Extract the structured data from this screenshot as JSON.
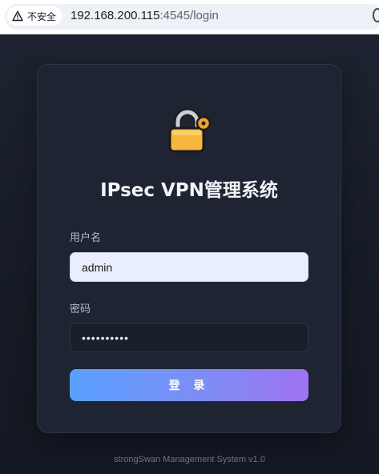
{
  "browser": {
    "security_label": "不安全",
    "url_host": "192.168.200.115",
    "url_path": ":4545/login"
  },
  "login": {
    "title": "IPsec VPN管理系统",
    "username_label": "用户名",
    "username_value": "admin",
    "password_label": "密码",
    "password_value": "1234567890",
    "submit_label": "登 录"
  },
  "footer": {
    "text": "strongSwan Management System v1.0"
  },
  "icons": {
    "security": "warning-triangle-icon",
    "logo": "lock-key-icon"
  },
  "colors": {
    "background": "#161b25",
    "card": "#1f2433",
    "button_gradient_start": "#5aa1ff",
    "button_gradient_end": "#9f73f1"
  }
}
